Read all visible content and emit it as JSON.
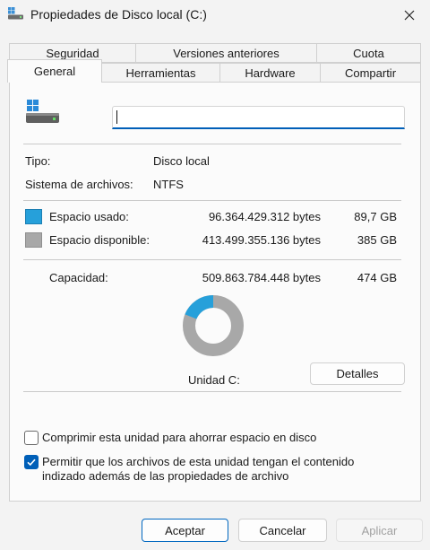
{
  "window": {
    "title": "Propiedades de Disco local (C:)"
  },
  "tabs": {
    "row1": [
      "Seguridad",
      "Versiones anteriores",
      "Cuota"
    ],
    "row2": [
      "General",
      "Herramientas",
      "Hardware",
      "Compartir"
    ],
    "active": "General"
  },
  "general": {
    "drive_name_value": "",
    "type_label": "Tipo:",
    "type_value": "Disco local",
    "fs_label": "Sistema de archivos:",
    "fs_value": "NTFS",
    "used_label": "Espacio usado:",
    "used_bytes": "96.364.429.312 bytes",
    "used_size": "89,7 GB",
    "free_label": "Espacio disponible:",
    "free_bytes": "413.499.355.136 bytes",
    "free_size": "385 GB",
    "capacity_label": "Capacidad:",
    "capacity_bytes": "509.863.784.448 bytes",
    "capacity_size": "474 GB",
    "drive_label": "Unidad C:",
    "details_button": "Detalles",
    "used_fraction": 0.189,
    "colors": {
      "used": "#26a0da",
      "free": "#a8a8a8"
    },
    "compress_label": "Comprimir esta unidad para ahorrar espacio en disco",
    "compress_checked": false,
    "index_label_line1": "Permitir que los archivos de esta unidad tengan el contenido",
    "index_label_line2": "indizado además de las propiedades de archivo",
    "index_checked": true
  },
  "footer": {
    "ok": "Aceptar",
    "cancel": "Cancelar",
    "apply": "Aplicar"
  },
  "icons": {
    "app": "drive-icon",
    "close": "close-icon",
    "drive_large": "drive-icon",
    "checkmark": "checkmark-icon"
  }
}
